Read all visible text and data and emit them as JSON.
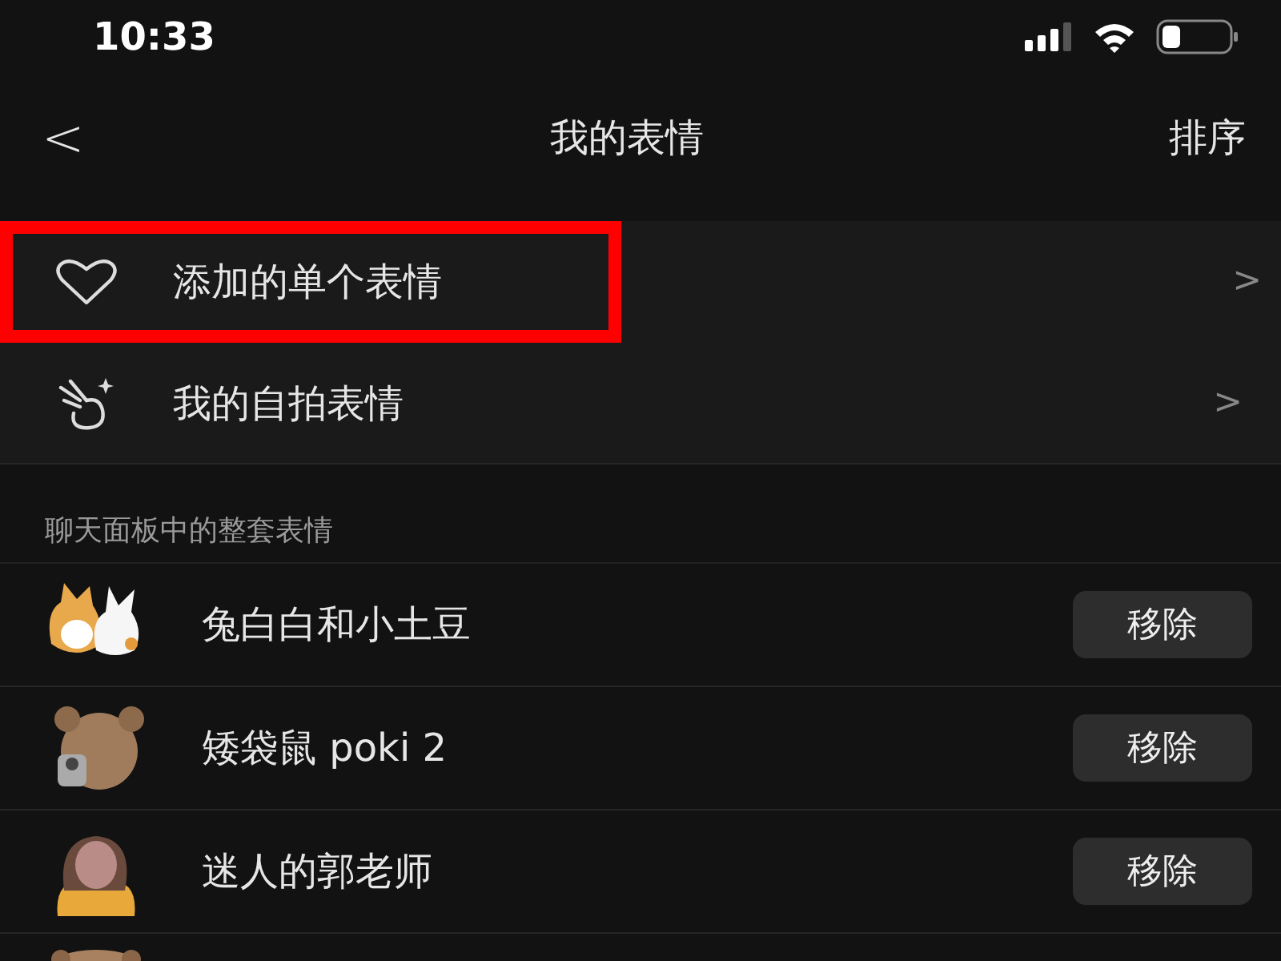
{
  "status_bar": {
    "time": "10:33"
  },
  "nav": {
    "back": "<",
    "title": "我的表情",
    "action": "排序"
  },
  "menu": [
    {
      "kind": "heart",
      "label": "添加的单个表情",
      "highlighted": true,
      "chevron": ">"
    },
    {
      "kind": "selfie",
      "label": "我的自拍表情",
      "highlighted": false,
      "chevron": ">"
    }
  ],
  "section": {
    "title": "聊天面板中的整套表情"
  },
  "packs": [
    {
      "kind": "corgi-bunny",
      "name": "兔白白和小土豆",
      "button": "移除"
    },
    {
      "kind": "quokka",
      "name": "矮袋鼠 poki 2",
      "button": "移除"
    },
    {
      "kind": "girl",
      "name": "迷人的郭老师",
      "button": "移除"
    },
    {
      "kind": "dog"
    }
  ]
}
